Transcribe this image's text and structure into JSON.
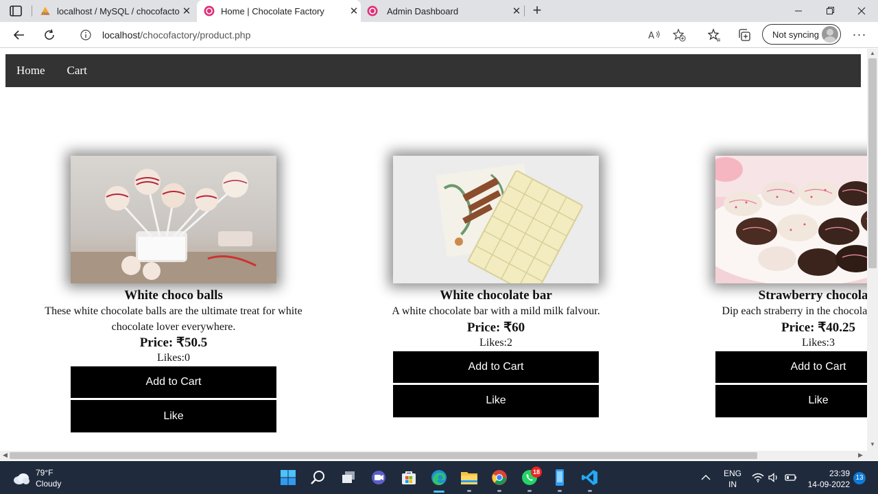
{
  "browser": {
    "tabs": [
      {
        "title": "localhost / MySQL / chocofactory",
        "active": false
      },
      {
        "title": "Home | Chocolate Factory",
        "active": true
      },
      {
        "title": "Admin Dashboard",
        "active": false
      }
    ],
    "url_host": "localhost",
    "url_path": "/chocofactory/product.php",
    "sync_label": "Not syncing"
  },
  "site": {
    "nav": [
      {
        "label": "Home"
      },
      {
        "label": "Cart"
      }
    ],
    "products": [
      {
        "name": "White choco balls",
        "description": "These white chocolate balls are the ultimate treat for white chocolate lover everywhere.",
        "price": "Price: ₹50.5",
        "likes": "Likes:0",
        "add_label": "Add to Cart",
        "like_label": "Like"
      },
      {
        "name": "White chocolate bar",
        "description": "A white chocolate bar with a mild milk falvour.",
        "price": "Price: ₹60",
        "likes": "Likes:2",
        "add_label": "Add to Cart",
        "like_label": "Like"
      },
      {
        "name": "Strawberry chocolate",
        "description": "Dip each straberry in the chocolate and coat",
        "price": "Price: ₹40.25",
        "likes": "Likes:3",
        "add_label": "Add to Cart",
        "like_label": "Like"
      }
    ]
  },
  "taskbar": {
    "weather_temp": "79°F",
    "weather_desc": "Cloudy",
    "lang_1": "ENG",
    "lang_2": "IN",
    "time": "23:39",
    "date": "14-09-2022",
    "whatsapp_badge": "18",
    "notification_count": "13"
  },
  "colors": {
    "nav_bg": "#333333",
    "button_bg": "#000000",
    "taskbar_bg": "#1f2b3d",
    "tabbar_bg": "#dfe1e5"
  }
}
